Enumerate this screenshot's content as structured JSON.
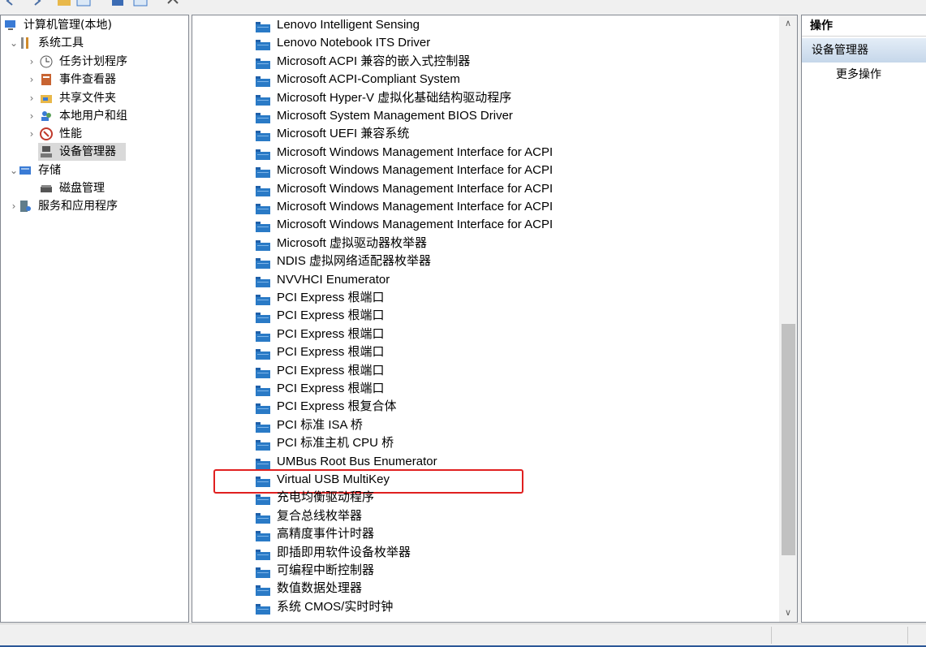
{
  "left_tree": {
    "items": [
      {
        "label": "计算机管理(本地)",
        "icon": "computer-management-icon",
        "expander": ""
      },
      {
        "label": "系统工具",
        "icon": "system-tools-icon",
        "expander": "⌄"
      },
      {
        "label": "任务计划程序",
        "icon": "task-scheduler-icon",
        "expander": "›"
      },
      {
        "label": "事件查看器",
        "icon": "event-viewer-icon",
        "expander": "›"
      },
      {
        "label": "共享文件夹",
        "icon": "shared-folders-icon",
        "expander": "›"
      },
      {
        "label": "本地用户和组",
        "icon": "local-users-icon",
        "expander": "›"
      },
      {
        "label": "性能",
        "icon": "performance-icon",
        "expander": "›"
      },
      {
        "label": "设备管理器",
        "icon": "device-manager-icon",
        "expander": ""
      },
      {
        "label": "存储",
        "icon": "storage-icon",
        "expander": "⌄"
      },
      {
        "label": "磁盘管理",
        "icon": "disk-management-icon",
        "expander": ""
      },
      {
        "label": "服务和应用程序",
        "icon": "services-apps-icon",
        "expander": "›"
      }
    ]
  },
  "device_list": {
    "items": [
      "Lenovo Intelligent Sensing",
      "Lenovo Notebook ITS Driver",
      "Microsoft ACPI 兼容的嵌入式控制器",
      "Microsoft ACPI-Compliant System",
      "Microsoft Hyper-V 虚拟化基础结构驱动程序",
      "Microsoft System Management BIOS Driver",
      "Microsoft UEFI 兼容系统",
      "Microsoft Windows Management Interface for ACPI",
      "Microsoft Windows Management Interface for ACPI",
      "Microsoft Windows Management Interface for ACPI",
      "Microsoft Windows Management Interface for ACPI",
      "Microsoft Windows Management Interface for ACPI",
      "Microsoft 虚拟驱动器枚举器",
      "NDIS 虚拟网络适配器枚举器",
      "NVVHCI Enumerator",
      "PCI Express 根端口",
      "PCI Express 根端口",
      "PCI Express 根端口",
      "PCI Express 根端口",
      "PCI Express 根端口",
      "PCI Express 根端口",
      "PCI Express 根复合体",
      "PCI 标准 ISA 桥",
      "PCI 标准主机 CPU 桥",
      "UMBus Root Bus Enumerator",
      "Virtual USB MultiKey",
      "充电均衡驱动程序",
      "复合总线枚举器",
      "高精度事件计时器",
      "即插即用软件设备枚举器",
      "可编程中断控制器",
      "数值数据处理器",
      "系统 CMOS/实时时钟"
    ],
    "highlighted": "Virtual USB MultiKey"
  },
  "actions_pane": {
    "title": "操作",
    "section": "设备管理器",
    "more": "更多操作"
  },
  "colors": {
    "selection": "#d9d9d9",
    "highlight_border": "#e02020",
    "actions_header": "#c6d7ea",
    "device_icon": "#2a7ac6"
  }
}
